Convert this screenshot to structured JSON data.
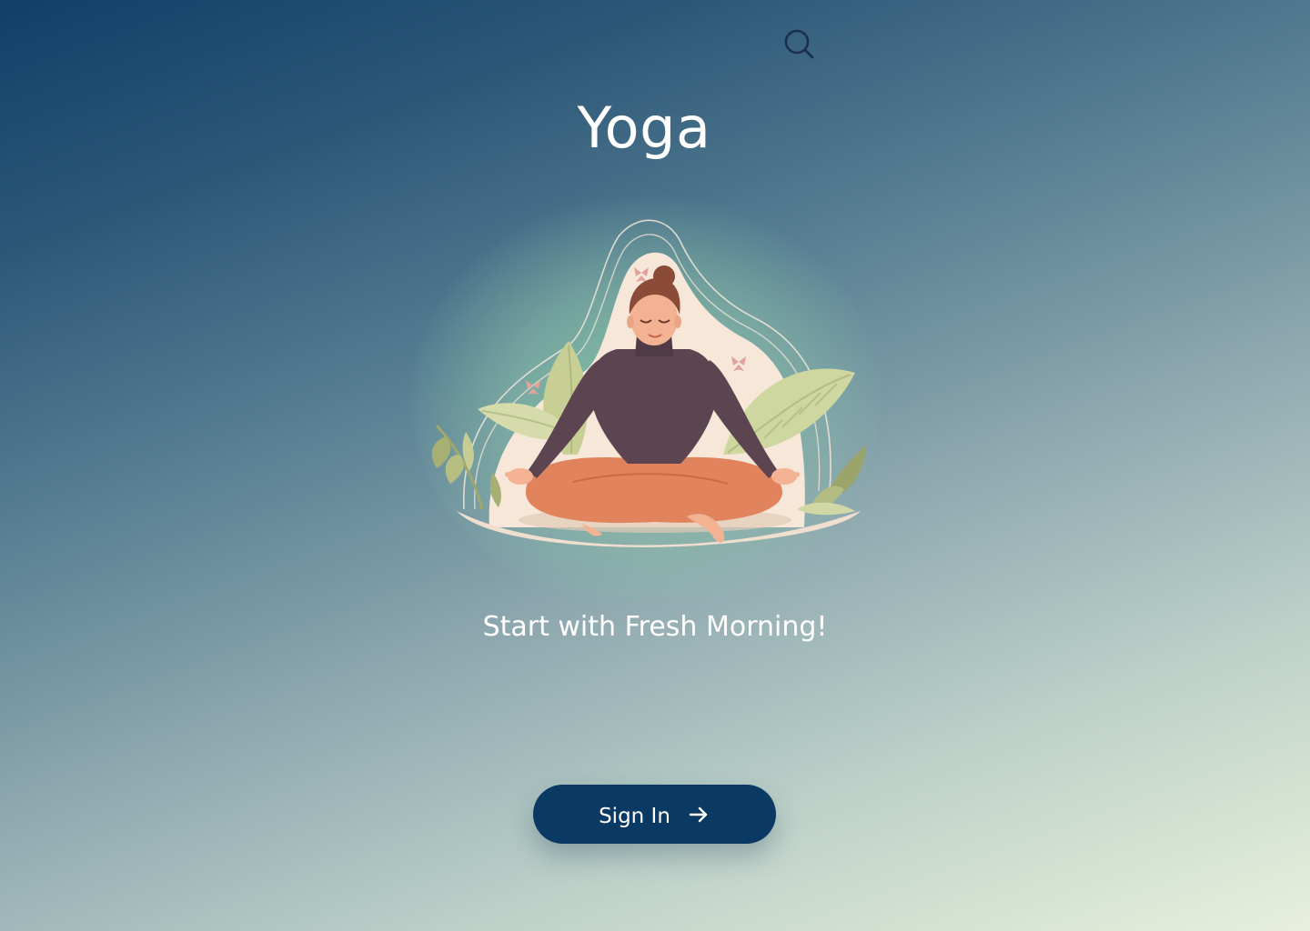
{
  "app": {
    "title": "Yoga",
    "tagline": "Start with Fresh Morning!"
  },
  "header": {
    "search_icon": "search-icon"
  },
  "hero": {
    "illustration": "meditating-woman-illustration"
  },
  "actions": {
    "sign_in_label": "Sign In",
    "sign_in_icon": "arrow-right-icon"
  },
  "colors": {
    "button_background": "#0a3a64",
    "text": "#ffffff",
    "gradient_top": "#0f3f69",
    "gradient_bottom": "#e8f0dc"
  }
}
